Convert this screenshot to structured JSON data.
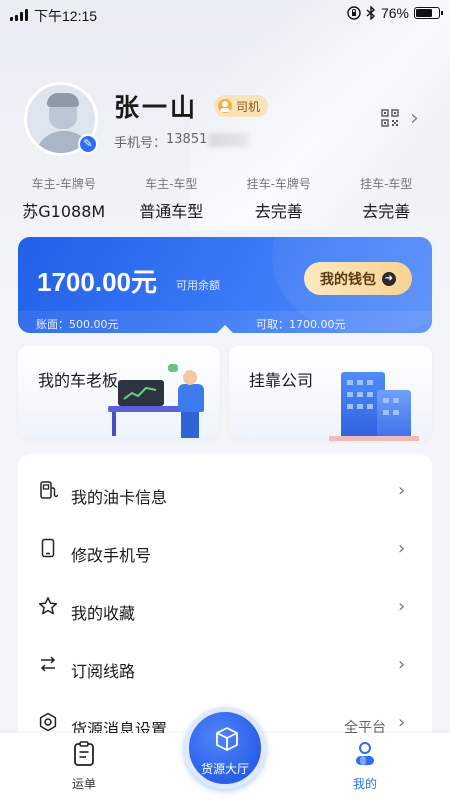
{
  "status_bar": {
    "time": "下午12:15",
    "battery": "76%",
    "battery_level": 0.76
  },
  "profile": {
    "name": "张一山",
    "role": "司机",
    "phone_label": "手机号：",
    "phone_visible": "13851"
  },
  "vehicle": [
    {
      "label": "车主-车牌号",
      "value": "苏G1088M"
    },
    {
      "label": "车主-车型",
      "value": "普通车型"
    },
    {
      "label": "挂车-车牌号",
      "value": "去完善"
    },
    {
      "label": "挂车-车型",
      "value": "去完善"
    }
  ],
  "wallet": {
    "amount": "1700.00元",
    "amount_label": "可用余额",
    "button_label": "我的钱包",
    "book_balance": "账面：500.00元",
    "withdrawable": "可取：1700.00元"
  },
  "cards": {
    "boss_title": "我的车老板",
    "company_title": "挂靠公司"
  },
  "menu": [
    {
      "label": "我的油卡信息",
      "icon": "fuel-card-icon"
    },
    {
      "label": "修改手机号",
      "icon": "phone-icon"
    },
    {
      "label": "我的收藏",
      "icon": "star-icon"
    },
    {
      "label": "订阅线路",
      "icon": "route-icon"
    },
    {
      "label": "货源消息设置",
      "icon": "settings-icon",
      "value": "全平台"
    }
  ],
  "bottom_nav": {
    "waybill": "运单",
    "hub": "货源大厅",
    "mine": "我的",
    "active": "mine"
  },
  "colors": {
    "accent": "#2b6ff5",
    "wallet_start": "#2260e8",
    "wallet_button": "#f8d293",
    "role_badge": "#fbe3b8"
  }
}
